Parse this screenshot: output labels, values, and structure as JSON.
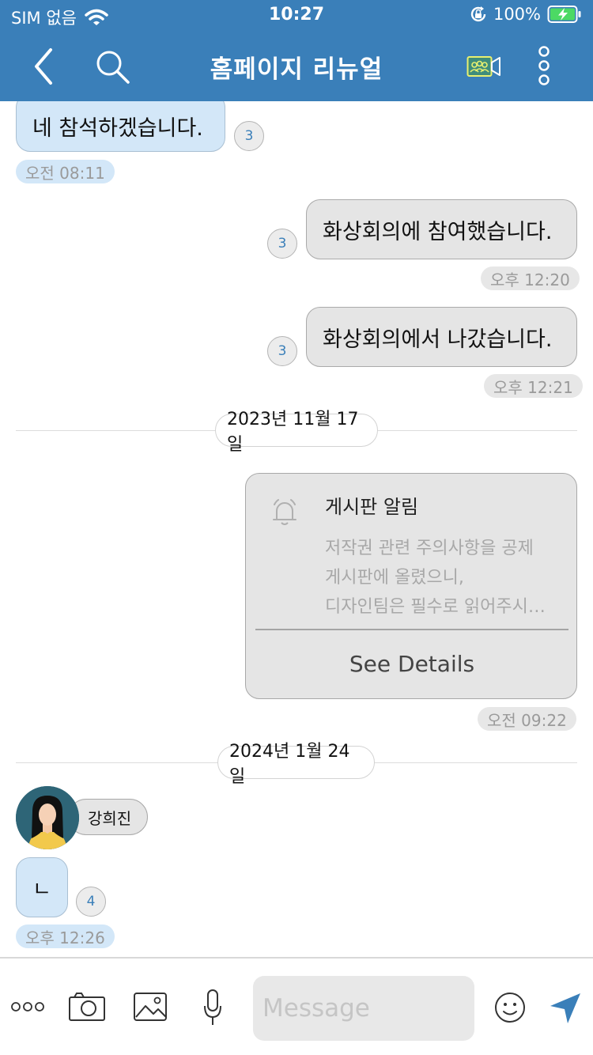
{
  "status_bar": {
    "carrier": "SIM 없음",
    "time": "10:27",
    "battery": "100%"
  },
  "header": {
    "title": "홈페이지 리뉴얼",
    "icons": [
      "back-icon",
      "search-icon",
      "video-conference-icon",
      "more-vertical-icon"
    ],
    "background": "#3a7fb9"
  },
  "messages": [
    {
      "direction": "in",
      "text": "네 참석하겠습니다.",
      "unread": "3",
      "time": "오전 08:11"
    },
    {
      "direction": "out",
      "text": "화상회의에 참여했습니다.",
      "unread": "3",
      "time": "오후 12:20"
    },
    {
      "direction": "out",
      "text": "화상회의에서 나갔습니다.",
      "unread": "3",
      "time": "오후 12:21"
    }
  ],
  "date_separators": [
    "2023년 11월 17일",
    "2024년 1월 24일"
  ],
  "notice_card": {
    "icon": "bell-icon",
    "title": "게시판 알림",
    "body_lines": [
      "저작권 관련 주의사항을 공제",
      "게시판에 올렸으니,",
      "디자인팀은 필수로 읽어주시…"
    ],
    "button": "See Details",
    "time": "오전 09:22"
  },
  "incoming": {
    "sender": "강희진",
    "text": "ㄴ",
    "unread": "4",
    "time": "오후 12:26"
  },
  "input_bar": {
    "placeholder": "Message",
    "tools": [
      "more-dots-icon",
      "camera-icon",
      "image-icon",
      "microphone-icon",
      "emoji-icon",
      "send-icon"
    ]
  },
  "colors": {
    "brand": "#3a7fb9",
    "incoming_bubble": "#d3e7f8",
    "outgoing_bubble": "#e5e5e5"
  }
}
